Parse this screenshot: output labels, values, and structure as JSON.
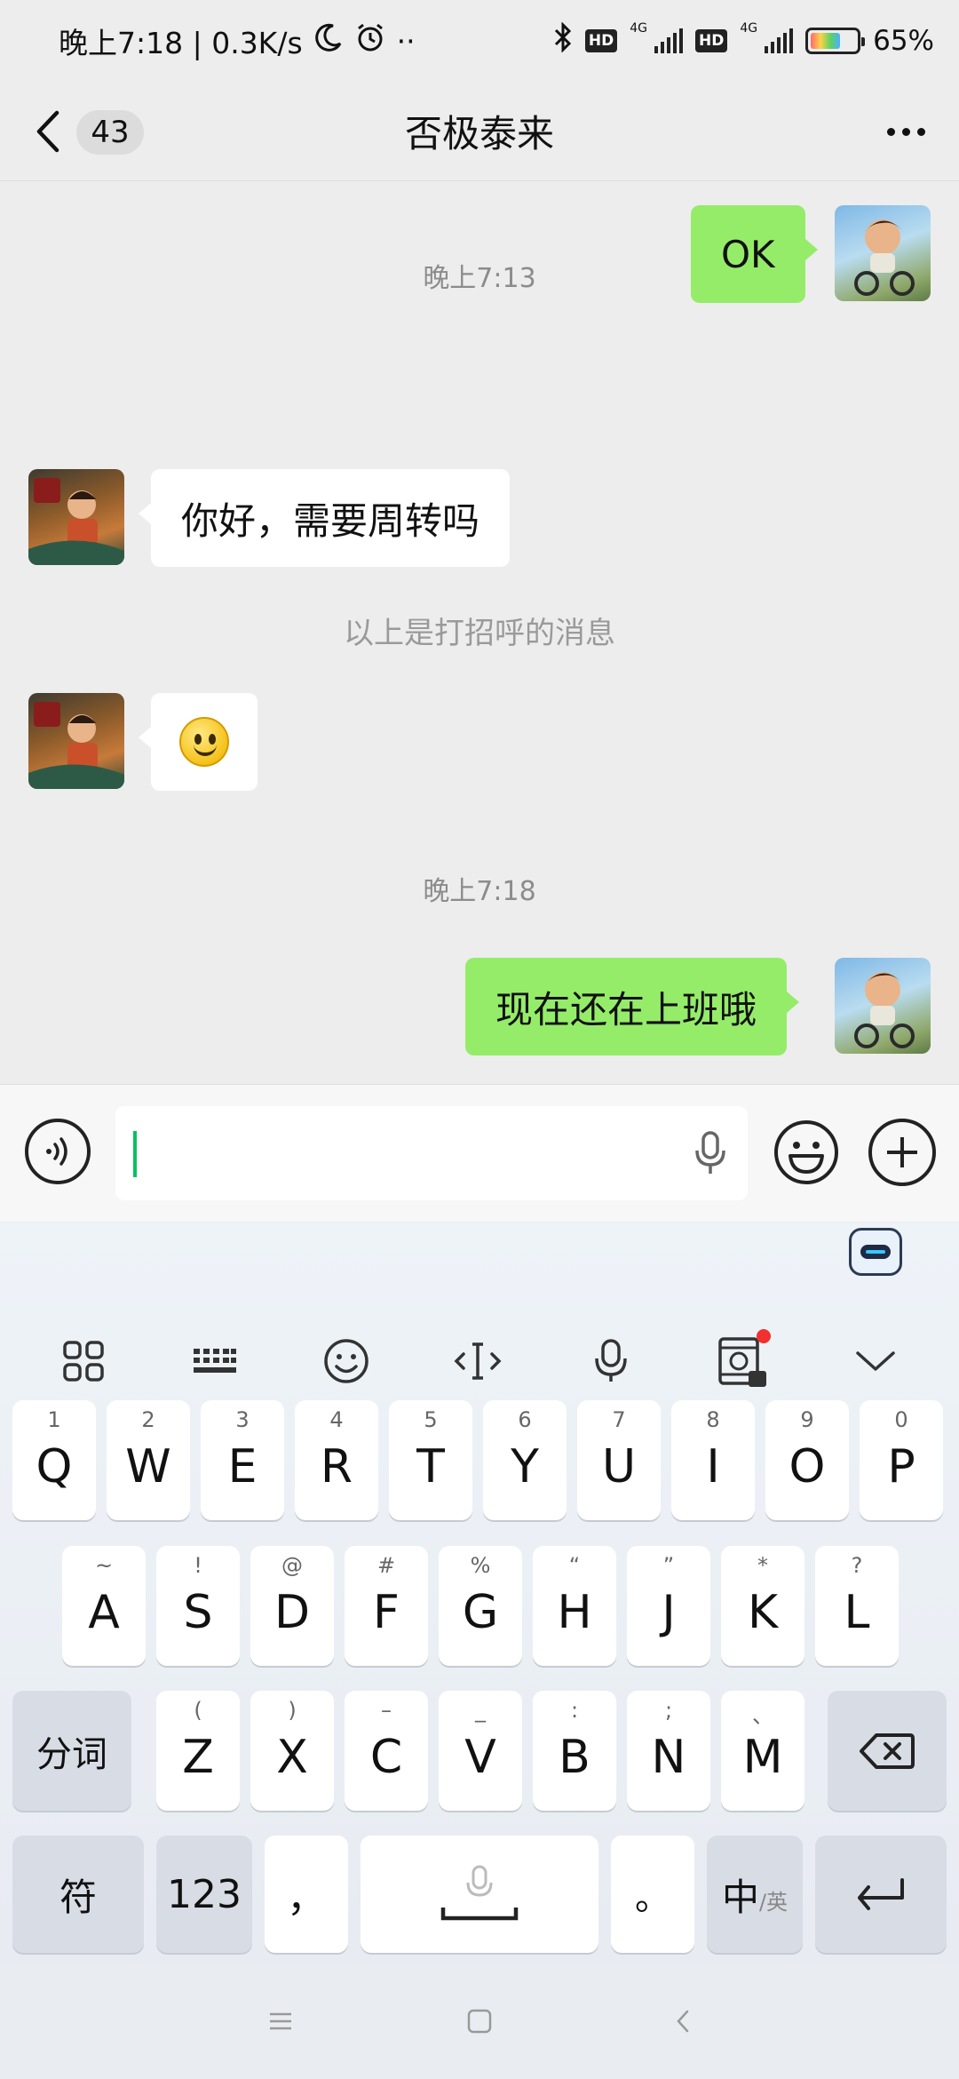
{
  "status_bar": {
    "left_text": "晚上7:18 | 0.3K/s",
    "moon_icon": "moon-icon",
    "alarm_icon": "alarm-icon",
    "dots": "··",
    "hd1": "HD",
    "hd2": "HD",
    "net1": "4G",
    "net2": "4G",
    "battery_percent": "65%",
    "battery_level": 0.65
  },
  "header": {
    "unread_count": "43",
    "title": "否极泰来"
  },
  "messages": {
    "msg1": "OK",
    "time1": "晚上7:13",
    "msg2": "你好，需要周转吗",
    "system_note": "以上是打招呼的消息",
    "time2": "晚上7:18",
    "msg4": "现在还在上班哦"
  },
  "keyboard": {
    "row1": [
      {
        "sub": "1",
        "key": "Q"
      },
      {
        "sub": "2",
        "key": "W"
      },
      {
        "sub": "3",
        "key": "E"
      },
      {
        "sub": "4",
        "key": "R"
      },
      {
        "sub": "5",
        "key": "T"
      },
      {
        "sub": "6",
        "key": "Y"
      },
      {
        "sub": "7",
        "key": "U"
      },
      {
        "sub": "8",
        "key": "I"
      },
      {
        "sub": "9",
        "key": "O"
      },
      {
        "sub": "0",
        "key": "P"
      }
    ],
    "row2": [
      {
        "sub": "~",
        "key": "A"
      },
      {
        "sub": "!",
        "key": "S"
      },
      {
        "sub": "@",
        "key": "D"
      },
      {
        "sub": "#",
        "key": "F"
      },
      {
        "sub": "%",
        "key": "G"
      },
      {
        "sub": "“",
        "key": "H"
      },
      {
        "sub": "”",
        "key": "J"
      },
      {
        "sub": "*",
        "key": "K"
      },
      {
        "sub": "?",
        "key": "L"
      }
    ],
    "row3": [
      {
        "sub": "(",
        "key": "Z"
      },
      {
        "sub": ")",
        "key": "X"
      },
      {
        "sub": "–",
        "key": "C"
      },
      {
        "sub": "_",
        "key": "V"
      },
      {
        "sub": ":",
        "key": "B"
      },
      {
        "sub": ";",
        "key": "N"
      },
      {
        "sub": "、",
        "key": "M"
      }
    ],
    "fenci": "分词",
    "symbols": "符",
    "numbers": "123",
    "comma": "，",
    "period": "。",
    "lang_main": "中",
    "lang_sub": "/英"
  }
}
